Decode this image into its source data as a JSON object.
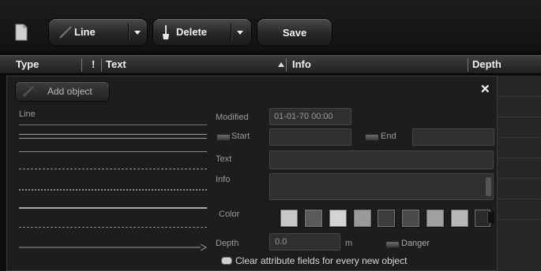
{
  "toolbar": {
    "line_label": "Line",
    "delete_label": "Delete",
    "save_label": "Save"
  },
  "header": {
    "type": "Type",
    "sort_marker": "!",
    "text": "Text",
    "info": "Info",
    "depth": "Depth"
  },
  "panel": {
    "add_object_label": "Add object",
    "close_glyph": "✕",
    "line_section_label": "Line",
    "modified_label": "Modified",
    "modified_value": "01-01-70 00:00",
    "start_label": "Start",
    "end_label": "End",
    "text_label": "Text",
    "info_label": "Info",
    "color_label": "Color",
    "depth_label": "Depth",
    "depth_value": "0.0",
    "depth_unit": "m",
    "danger_label": "Danger",
    "clear_label": "Clear attribute fields for every new object"
  },
  "colors": {
    "swatches": [
      "#c8c8c8",
      "#5a5a5a",
      "#d4d4d4",
      "#9a9a9a",
      "#3c3c3c",
      "#4a4a4a",
      "#a0a0a0",
      "#b8b8b8",
      "#2a2a2a"
    ]
  },
  "line_styles": [
    "solid-thin",
    "solid-double",
    "dashed",
    "dotted",
    "solid-thick",
    "dashed-long",
    "arrow"
  ]
}
